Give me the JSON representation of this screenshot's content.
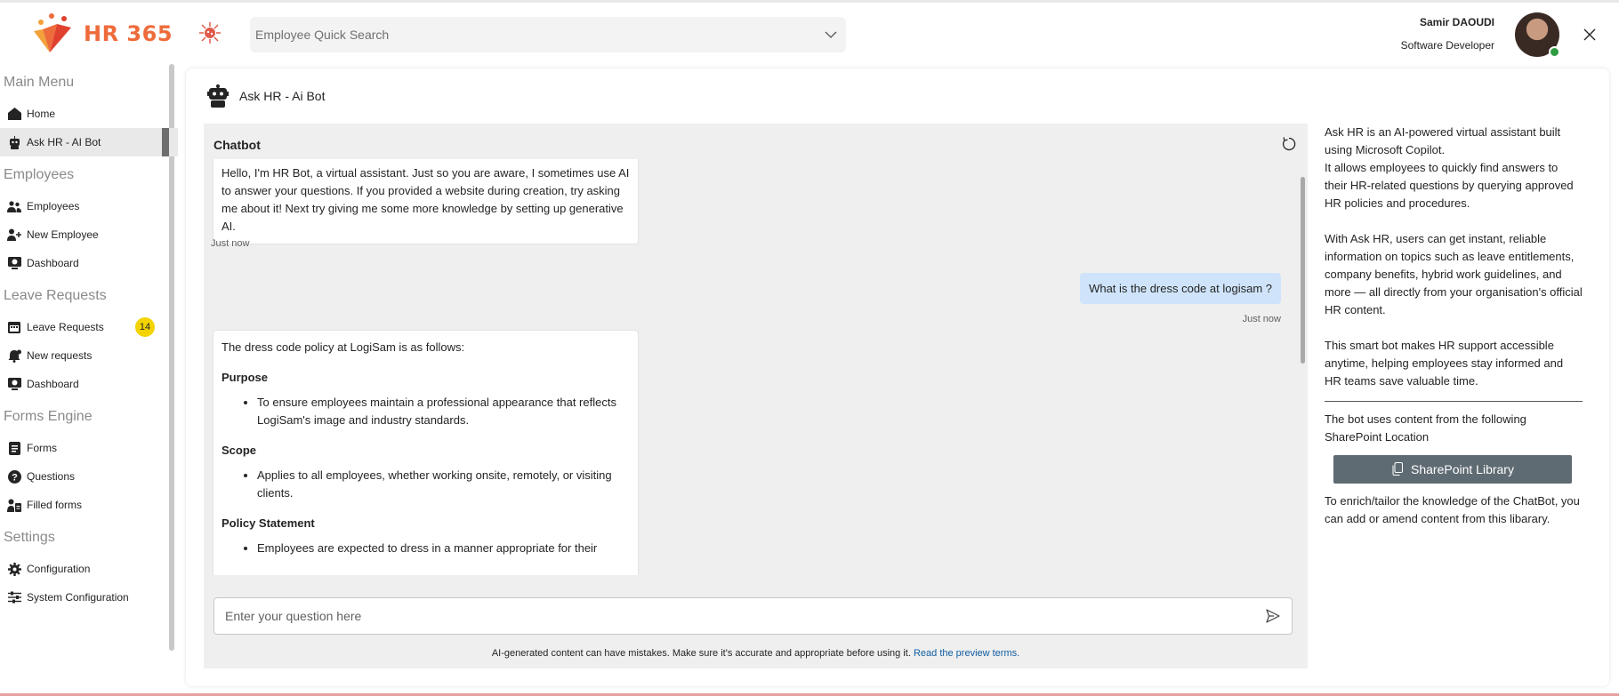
{
  "app": {
    "logo_text": "HR 365"
  },
  "search": {
    "placeholder": "Employee Quick Search"
  },
  "user": {
    "name": "Samir DAOUDI",
    "role": "Software Developer"
  },
  "sidebar": {
    "sections": [
      {
        "title": "Main Menu",
        "items": [
          {
            "label": "Home",
            "icon": "home-icon"
          },
          {
            "label": "Ask HR - AI Bot",
            "icon": "bot-icon",
            "active": true
          }
        ]
      },
      {
        "title": "Employees",
        "items": [
          {
            "label": "Employees",
            "icon": "people-icon"
          },
          {
            "label": "New Employee",
            "icon": "person-add-icon"
          },
          {
            "label": "Dashboard",
            "icon": "dashboard-icon"
          }
        ]
      },
      {
        "title": "Leave Requests",
        "items": [
          {
            "label": "Leave Requests",
            "icon": "calendar-icon",
            "badge": "14"
          },
          {
            "label": "New requests",
            "icon": "bell-icon"
          },
          {
            "label": "Dashboard",
            "icon": "dashboard-icon"
          }
        ]
      },
      {
        "title": "Forms Engine",
        "items": [
          {
            "label": "Forms",
            "icon": "form-icon"
          },
          {
            "label": "Questions",
            "icon": "question-icon"
          },
          {
            "label": "Filled forms",
            "icon": "person-doc-icon"
          }
        ]
      },
      {
        "title": "Settings",
        "items": [
          {
            "label": "Configuration",
            "icon": "gear-icon"
          },
          {
            "label": "System Configuration",
            "icon": "sliders-icon"
          }
        ]
      }
    ]
  },
  "page": {
    "title": "Ask HR - Ai Bot"
  },
  "chat": {
    "title": "Chatbot",
    "welcome": "Hello, I'm HR Bot, a virtual assistant. Just so you are aware, I sometimes use AI to answer your questions. If you provided a website during creation, try asking me about it! Next try giving me some more knowledge by setting up generative AI.",
    "welcome_time": "Just now",
    "user_msg": "What is the dress code at logisam ?",
    "user_time": "Just now",
    "answer": {
      "intro": "The dress code policy at LogiSam is as follows:",
      "h1": "Purpose",
      "p1": "To ensure employees maintain a professional appearance that reflects LogiSam's image and industry standards.",
      "h2": "Scope",
      "p2": "Applies to all employees, whether working onsite, remotely, or visiting clients.",
      "h3": "Policy Statement",
      "p3": "Employees are expected to dress in a manner appropriate for their"
    },
    "input_placeholder": "Enter your question here",
    "disclaimer": "AI-generated content can have mistakes. Make sure it's accurate and appropriate before using it.",
    "disclaimer_link": "Read the preview terms."
  },
  "info": {
    "p1": "Ask HR is an AI-powered virtual assistant built using Microsoft Copilot.\nIt allows employees to quickly find answers to their HR-related questions by querying approved HR policies and procedures.",
    "p2": "With Ask HR, users can get instant, reliable information on topics such as leave entitlements, company benefits, hybrid work guidelines, and more — all directly from your organisation's official HR content.",
    "p3": "This smart bot makes HR support accessible anytime, helping employees stay informed and HR teams save valuable time.",
    "p4": "The bot uses content from the following SharePoint Location",
    "button": "SharePoint Library",
    "p5": "To enrich/tailor the knowledge of the ChatBot, you can add or amend content from this libarary."
  },
  "colors": {
    "accent": "#ee6b3b",
    "user_bubble": "#cfe4fa",
    "badge": "#f3d400",
    "button": "#5f6b72"
  }
}
